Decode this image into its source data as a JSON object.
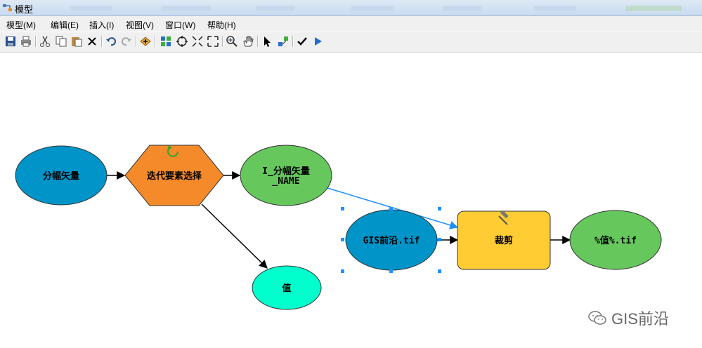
{
  "window": {
    "title": "模型"
  },
  "menu": [
    "模型(M)",
    "编辑(E)",
    "插入(I)",
    "视图(V)",
    "窗口(W)",
    "帮助(H)"
  ],
  "toolbar_icons": [
    "save-icon",
    "print-icon",
    "cut-icon",
    "copy-icon",
    "paste-icon",
    "delete-icon",
    "undo-icon",
    "redo-icon",
    "add-data-icon",
    "auto-layout-icon",
    "full-extent-icon",
    "zoom-in-fixed-icon",
    "zoom-out-fixed-icon",
    "zoom-in-icon",
    "pan-icon",
    "select-icon",
    "connect-icon",
    "validate-icon",
    "run-icon"
  ],
  "nodes": {
    "input_vector": {
      "label": "分幅矢量",
      "color": "#0094c8"
    },
    "iterator": {
      "label": "迭代要素选择",
      "color": "#f58a2a"
    },
    "name_var": {
      "label1": "I_分幅矢量",
      "label2": "_NAME",
      "color": "#65c75c"
    },
    "value_var": {
      "label": "值",
      "color": "#00ffcc"
    },
    "gis_tif": {
      "label": "GIS前沿.tif",
      "color": "#0094c8"
    },
    "clip_tool": {
      "label": "裁剪",
      "color": "#ffcc33"
    },
    "output_tif": {
      "label": "%值%.tif",
      "color": "#65c75c"
    }
  },
  "colors": {
    "selection": "#1e8fff",
    "link": "#1e8fff",
    "edge": "#000000"
  },
  "watermark": {
    "text": "GIS前沿"
  }
}
